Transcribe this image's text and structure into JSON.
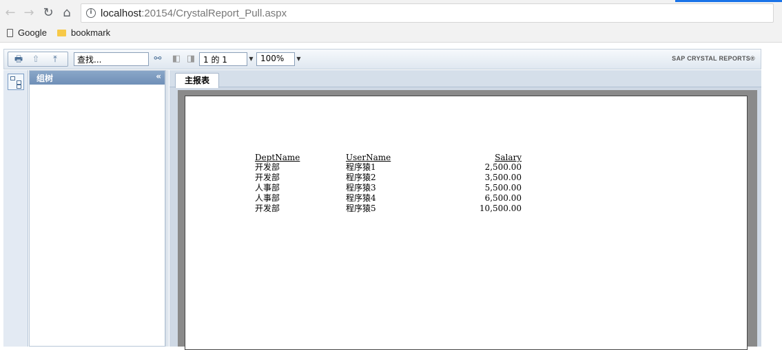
{
  "browser": {
    "url_host": "localhost",
    "url_path": ":20154/CrystalReport_Pull.aspx",
    "bookmarks": [
      {
        "label": "Google",
        "icon": "page-icon"
      },
      {
        "label": "bookmark",
        "icon": "folder-icon"
      }
    ]
  },
  "toolbar": {
    "search_value": "查找...",
    "page_value": "1 的 1",
    "zoom_value": "100%",
    "brand": "SAP CRYSTAL REPORTS®"
  },
  "tree_panel": {
    "title": "组树",
    "collapse_glyph": "«"
  },
  "tabs": [
    {
      "label": "主报表",
      "selected": true
    }
  ],
  "report": {
    "columns": [
      "DeptName",
      "UserName",
      "Salary"
    ],
    "rows": [
      {
        "dept": "开发部",
        "user": "程序猿1",
        "salary": "2,500.00"
      },
      {
        "dept": "开发部",
        "user": "程序猿2",
        "salary": "3,500.00"
      },
      {
        "dept": "人事部",
        "user": "程序猿3",
        "salary": "5,500.00"
      },
      {
        "dept": "人事部",
        "user": "程序猿4",
        "salary": "6,500.00"
      },
      {
        "dept": "开发部",
        "user": "程序猿5",
        "salary": "10,500.00"
      }
    ]
  },
  "colors": {
    "accent": "#1a73e8",
    "panel_header": "#7f9cc0",
    "report_background": "#8a8a8a"
  }
}
